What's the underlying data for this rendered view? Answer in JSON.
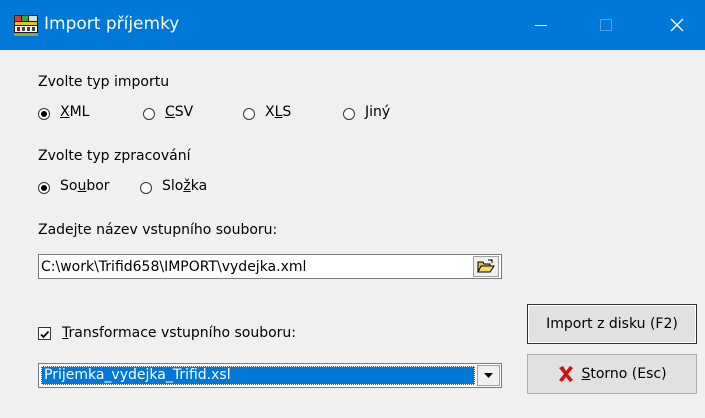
{
  "window": {
    "title": "Import příjemky",
    "accent": "#0078d7"
  },
  "import_type": {
    "label": "Zvolte typ importu",
    "options": [
      {
        "label": "XML",
        "mnemonic": "X",
        "rest": "ML",
        "checked": true
      },
      {
        "label": "CSV",
        "mnemonic": "C",
        "rest": "SV",
        "checked": false
      },
      {
        "label": "XLS",
        "pre": "X",
        "mnemonic": "L",
        "rest": "S",
        "checked": false
      },
      {
        "label": "Jiný",
        "mnemonic": "J",
        "rest": "iný",
        "checked": false
      }
    ]
  },
  "processing_type": {
    "label": "Zvolte typ zpracování",
    "options": [
      {
        "label": "Soubor",
        "pre": "So",
        "mnemonic": "u",
        "rest": "bor",
        "checked": true
      },
      {
        "label": "Složka",
        "pre": "Slo",
        "mnemonic": "ž",
        "rest": "ka",
        "checked": false
      }
    ]
  },
  "input_file": {
    "label": "Zadejte název vstupního souboru:",
    "value": "C:\\work\\Trifid658\\IMPORT\\vydejka.xml"
  },
  "transform": {
    "checked": true,
    "pre": "",
    "mnemonic": "T",
    "rest": "ransformace vstupního souboru:",
    "selected": "Prijemka_vydejka_Trifid.xsl"
  },
  "buttons": {
    "import_label": "Import z disku (F2)",
    "cancel_mnemonic": "S",
    "cancel_rest": "torno (Esc)"
  }
}
